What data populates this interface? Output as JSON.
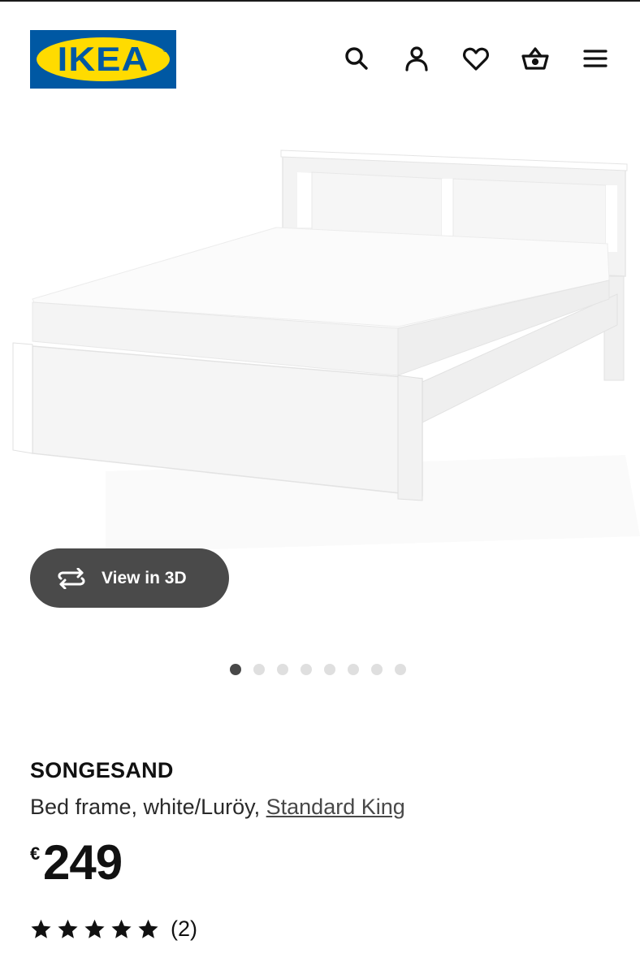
{
  "header": {
    "logo_text": "IKEA",
    "icons": [
      "search-icon",
      "account-icon",
      "heart-icon",
      "basket-icon",
      "menu-icon"
    ]
  },
  "gallery": {
    "view3d_label": "View in 3D",
    "image_count": 8,
    "active_index": 0
  },
  "product": {
    "name": "SONGESAND",
    "description_prefix": "Bed frame, white/Luröy, ",
    "size_link": "Standard King",
    "price_currency": "€",
    "price_amount": "249",
    "rating_stars": 5,
    "rating_count": "(2)"
  },
  "colors": {
    "ikea_blue": "#0058a3",
    "ikea_yellow": "#ffdb00",
    "button_dark": "#4a4a4a",
    "dot_active": "#484848",
    "dot_inactive": "#dfdfdf"
  }
}
